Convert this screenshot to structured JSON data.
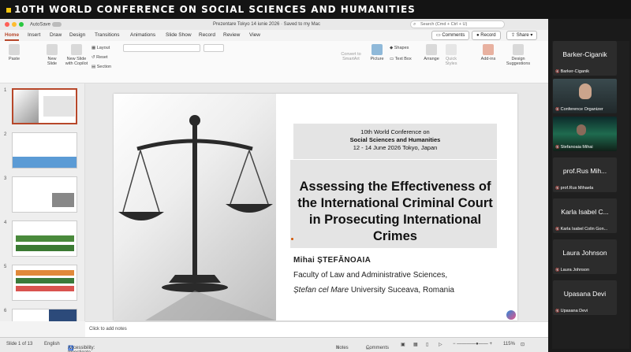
{
  "banner": {
    "title": "10TH WORLD CONFERENCE ON SOCIAL SCIENCES AND HUMANITIES"
  },
  "window": {
    "autosave_label": "AutoSave",
    "doc_title": "Prezentare Tokyo 14 iunie 2026 · Saved to my Mac",
    "search_placeholder": "Search (Cmd + Ctrl + U)"
  },
  "tabs": [
    "Home",
    "Insert",
    "Draw",
    "Design",
    "Transitions",
    "Animations",
    "Slide Show",
    "Record",
    "Review",
    "View"
  ],
  "top_buttons": {
    "comments": "Comments",
    "record": "Record",
    "share": "Share"
  },
  "ribbon": {
    "paste": "Paste",
    "new_slide": "New Slide",
    "new_slide_copilot": "New Slide with Copilot",
    "layout": "Layout",
    "reset": "Reset",
    "section": "Section",
    "convert_smartart": "Convert to SmartArt",
    "picture": "Picture",
    "shapes": "Shapes",
    "text_box": "Text Box",
    "arrange": "Arrange",
    "quick_styles": "Quick Styles",
    "addins": "Add-ins",
    "design_suggestions": "Design Suggestions"
  },
  "thumbnails": [
    {
      "num": "1",
      "selected": true
    },
    {
      "num": "2",
      "selected": false
    },
    {
      "num": "3",
      "selected": false
    },
    {
      "num": "4",
      "selected": false
    },
    {
      "num": "5",
      "selected": false
    },
    {
      "num": "6",
      "selected": false
    }
  ],
  "slide": {
    "conf_line1": "10th World Conference on",
    "conf_line2": "Social Sciences and Humanities",
    "conf_line3": "12 - 14 June 2026  Tokyo, Japan",
    "title": "Assessing the Effectiveness of the International Criminal Court in Prosecuting International Crimes",
    "author": "Mihai ȘTEFĂNOAIA",
    "faculty": "Faculty of Law and Administrative Sciences,",
    "university_italic": "Ștefan cel Mare",
    "university_rest": " University Suceava, Romania"
  },
  "notes_placeholder": "Click to add notes",
  "status": {
    "slide_count": "Slide 1 of 13",
    "language": "English",
    "accessibility": "Accessibility: Investigate",
    "notes": "Notes",
    "comments": "Comments",
    "zoom": "115%"
  },
  "participants": [
    {
      "big": "Barker-Ciganik",
      "small": "Barker-Ciganik",
      "kind": "name"
    },
    {
      "big": "",
      "small": "Conference Organizer",
      "kind": "video"
    },
    {
      "big": "",
      "small": "Stefanoaia Mihai",
      "kind": "aurora"
    },
    {
      "big": "prof.Rus Mih...",
      "small": "prof.Rus Mihaela",
      "kind": "name"
    },
    {
      "big": "Karla Isabel C...",
      "small": "Karla Isabel Colin Gon...",
      "kind": "name"
    },
    {
      "big": "Laura Johnson",
      "small": "Laura Johnson",
      "kind": "name"
    },
    {
      "big": "Upasana Devi",
      "small": "Upasana Devi",
      "kind": "name"
    }
  ],
  "colors": {
    "accent": "#b7472a",
    "banner_dot": "#f1c40f"
  }
}
